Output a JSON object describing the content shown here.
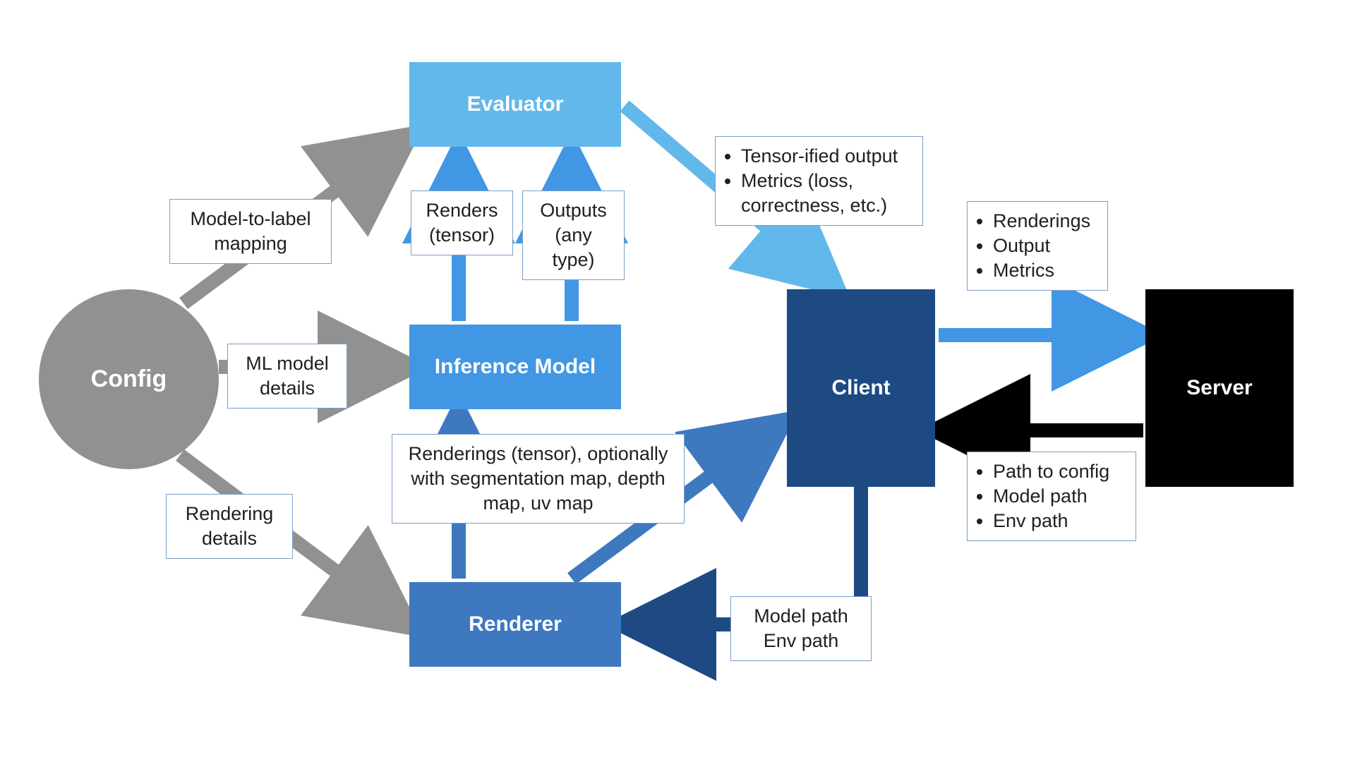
{
  "nodes": {
    "config": "Config",
    "evaluator": "Evaluator",
    "inference": "Inference Model",
    "renderer": "Renderer",
    "client": "Client",
    "server": "Server"
  },
  "labels": {
    "model_to_label": "Model-to-label mapping",
    "ml_model_details": "ML model details",
    "rendering_details": "Rendering details",
    "renders_tensor_l1": "Renders",
    "renders_tensor_l2": "(tensor)",
    "outputs_anytype_l1": "Outputs",
    "outputs_anytype_l2": "(any type)",
    "tensor_metrics_li1": "Tensor-ified output",
    "tensor_metrics_li2": "Metrics (loss, correctness, etc.)",
    "renderings_seg": "Renderings (tensor), optionally with segmentation map, depth map, uv map",
    "modelpath_envpath_l1": "Model path",
    "modelpath_envpath_l2": "Env path",
    "rom_li1": "Renderings",
    "rom_li2": "Output",
    "rom_li3": "Metrics",
    "ptc_li1": "Path to config",
    "ptc_li2": "Model path",
    "ptc_li3": "Env path"
  },
  "colors": {
    "gray": "#919191",
    "blue_light": "#62b8ea",
    "blue_mid": "#4197e3",
    "blue_dark": "#3e78bf",
    "navy": "#1d4a82",
    "black": "#000000"
  }
}
